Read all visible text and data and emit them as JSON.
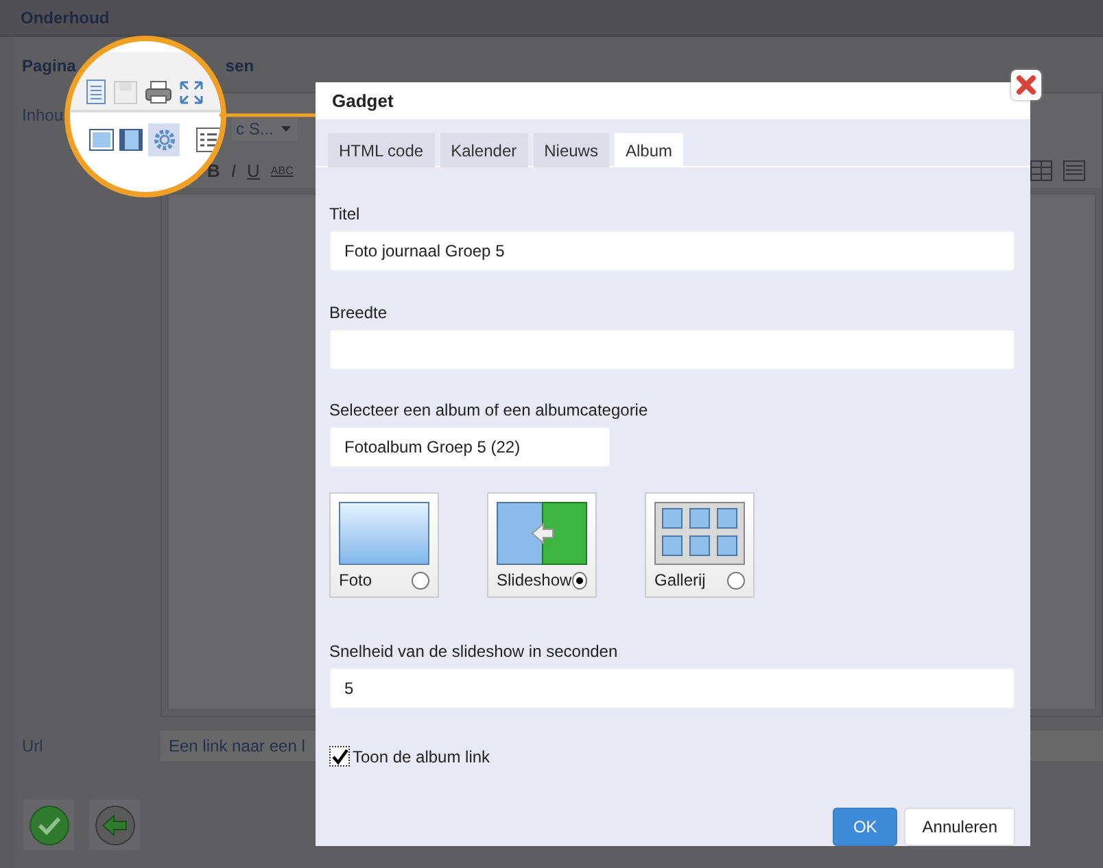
{
  "header": {
    "title": "Onderhoud"
  },
  "page": {
    "section_title": "Pagina",
    "section_title_tail": "sen",
    "content_label": "Inhou",
    "style_dropdown": "c S...",
    "format_buttons": [
      "B",
      "I",
      "U",
      "ABC"
    ],
    "url_label": "Url",
    "url_value": "Een link naar een l"
  },
  "magnifier": {
    "gear_selected": true
  },
  "dialog": {
    "title": "Gadget",
    "tabs": [
      {
        "label": "HTML code",
        "selected": false
      },
      {
        "label": "Kalender",
        "selected": false
      },
      {
        "label": "Nieuws",
        "selected": false
      },
      {
        "label": "Album",
        "selected": true
      }
    ],
    "title_field": {
      "label": "Titel",
      "value": "Foto journaal Groep 5"
    },
    "width_field": {
      "label": "Breedte"
    },
    "album_select": {
      "label": "Selecteer een album of een albumcategorie",
      "value": "Fotoalbum Groep 5 (22)"
    },
    "modes": [
      {
        "label": "Foto",
        "kind": "foto",
        "selected": false
      },
      {
        "label": "Slideshow",
        "kind": "slideshow",
        "selected": true
      },
      {
        "label": "Gallerij",
        "kind": "gallery",
        "selected": false
      }
    ],
    "speed_field": {
      "label": "Snelheid van de slideshow in seconden",
      "value": "5"
    },
    "show_link": {
      "label": "Toon de album link",
      "checked": true
    },
    "buttons": [
      {
        "label": "OK",
        "primary": true
      },
      {
        "label": "Annuleren",
        "primary": false
      }
    ]
  }
}
